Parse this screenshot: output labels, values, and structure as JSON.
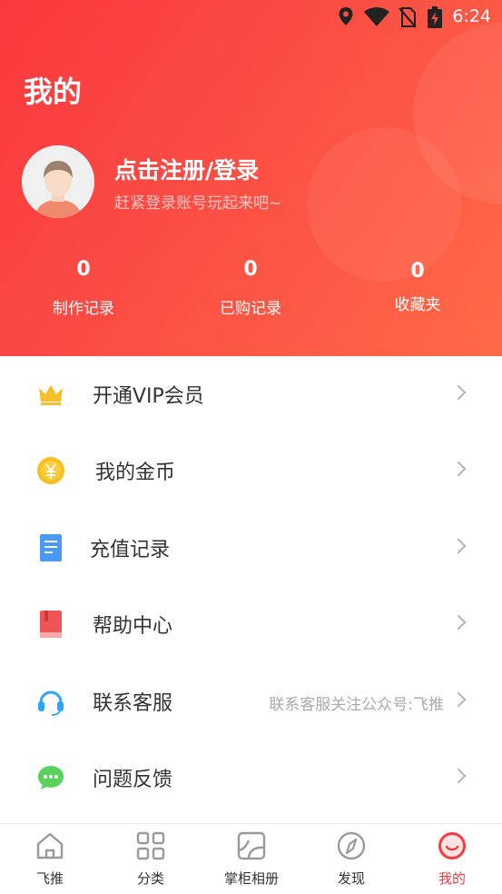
{
  "status_bar": {
    "time": "6:24",
    "icons": [
      "location-icon",
      "wifi-icon",
      "no-sim-icon",
      "battery-charging-icon"
    ]
  },
  "header": {
    "title": "我的",
    "login_title": "点击注册/登录",
    "login_subtitle": "赶紧登录账号玩起来吧~",
    "stats": [
      {
        "value": "0",
        "label": "制作记录"
      },
      {
        "value": "0",
        "label": "已购记录"
      },
      {
        "value": "0",
        "label": "收藏夹"
      }
    ]
  },
  "menu": [
    {
      "label": "开通VIP会员",
      "icon": "crown-icon",
      "extra": ""
    },
    {
      "label": "我的金币",
      "icon": "coin-icon",
      "extra": ""
    },
    {
      "label": "充值记录",
      "icon": "document-icon",
      "extra": ""
    },
    {
      "label": "帮助中心",
      "icon": "book-icon",
      "extra": ""
    },
    {
      "label": "联系客服",
      "icon": "headset-icon",
      "extra": "联系客服关注公众号:飞推"
    },
    {
      "label": "问题反馈",
      "icon": "chat-icon",
      "extra": ""
    }
  ],
  "tabs": [
    {
      "label": "飞推",
      "icon": "home-icon"
    },
    {
      "label": "分类",
      "icon": "grid-icon"
    },
    {
      "label": "掌柜相册",
      "icon": "album-icon"
    },
    {
      "label": "发现",
      "icon": "compass-icon"
    },
    {
      "label": "我的",
      "icon": "smile-icon",
      "active": true
    }
  ],
  "colors": {
    "accent": "#f53c3f",
    "header_start": "#f9383d",
    "header_end": "#ff6a47"
  }
}
